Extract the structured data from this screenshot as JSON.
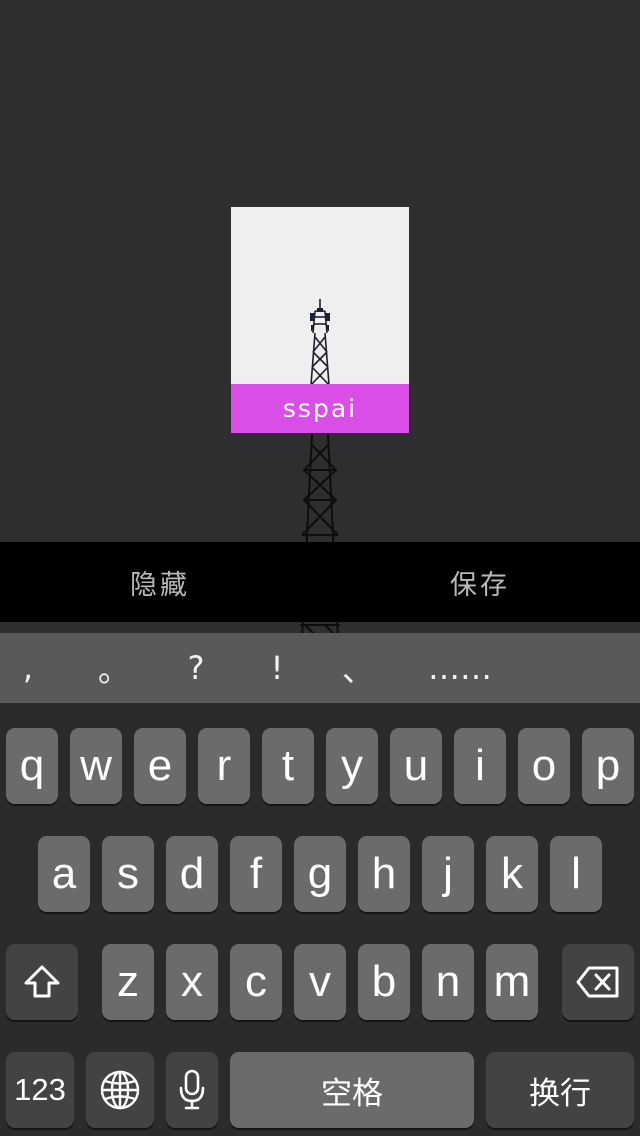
{
  "preview": {
    "watermark_text": "sspai",
    "watermark_color": "#d84ee6"
  },
  "actions": {
    "hide_label": "隐藏",
    "save_label": "保存"
  },
  "suggestions": [
    ",",
    "。",
    "?",
    "!",
    "、",
    "……"
  ],
  "keyboard": {
    "row1": [
      "q",
      "w",
      "e",
      "r",
      "t",
      "y",
      "u",
      "i",
      "o",
      "p"
    ],
    "row2": [
      "a",
      "s",
      "d",
      "f",
      "g",
      "h",
      "j",
      "k",
      "l"
    ],
    "row3": [
      "z",
      "x",
      "c",
      "v",
      "b",
      "n",
      "m"
    ],
    "numbers_label": "123",
    "space_label": "空格",
    "return_label": "换行",
    "shift_icon": "shift-icon",
    "delete_icon": "delete-icon",
    "globe_icon": "globe-icon",
    "mic_icon": "microphone-icon"
  },
  "colors": {
    "background": "#2e2e30",
    "key": "#6b6b6e",
    "function_key": "#434346",
    "suggestion_bar": "#59595c"
  }
}
